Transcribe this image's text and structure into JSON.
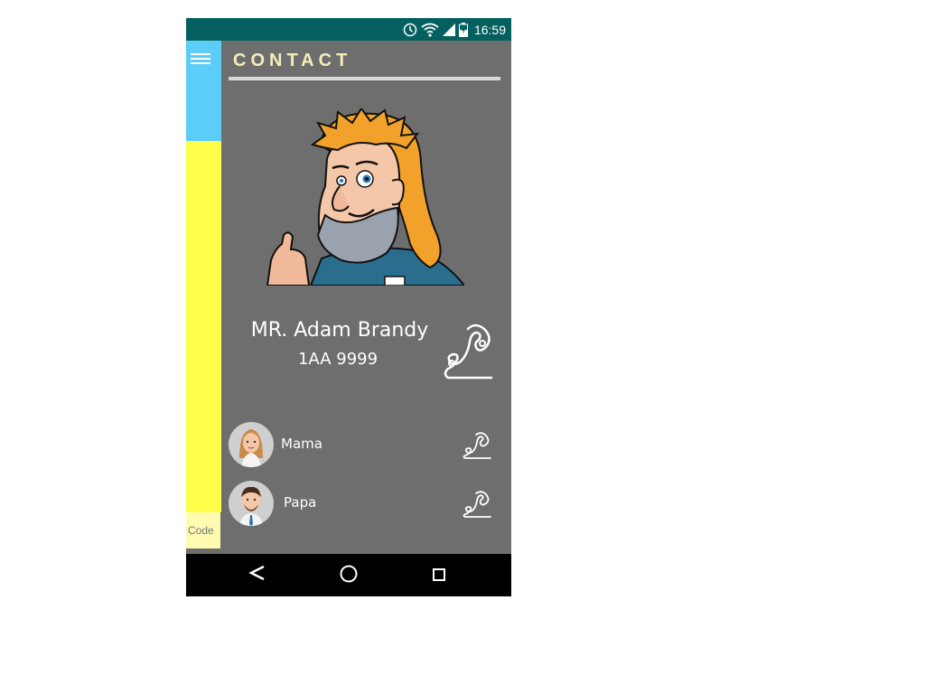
{
  "status_bar": {
    "time": "16:59",
    "icons": [
      "alarm-icon",
      "wifi-icon",
      "signal-icon",
      "battery-charging-icon"
    ]
  },
  "sidebar": {
    "menu_icon": "hamburger-menu-icon",
    "code_label": "Code",
    "colors": {
      "top": "#5ccdf8",
      "middle": "#ffff4a",
      "bottom": "#fffbb0"
    }
  },
  "header": {
    "title": "CONTACT"
  },
  "main_contact": {
    "name": "MR. Adam Brandy",
    "code": "1AA 9999",
    "avatar": "cartoon-man-avatar",
    "call_icon": "phone-handset-icon"
  },
  "contacts": [
    {
      "name": "Mama",
      "avatar": "woman-avatar",
      "call_icon": "phone-handset-icon"
    },
    {
      "name": "Papa",
      "avatar": "man-avatar",
      "call_icon": "phone-handset-icon"
    }
  ],
  "nav_bar": {
    "buttons": [
      "back-icon",
      "home-icon",
      "recents-icon"
    ]
  },
  "colors": {
    "status_bar": "#03605f",
    "background": "#6e6e6e",
    "title": "#f5eebb"
  }
}
